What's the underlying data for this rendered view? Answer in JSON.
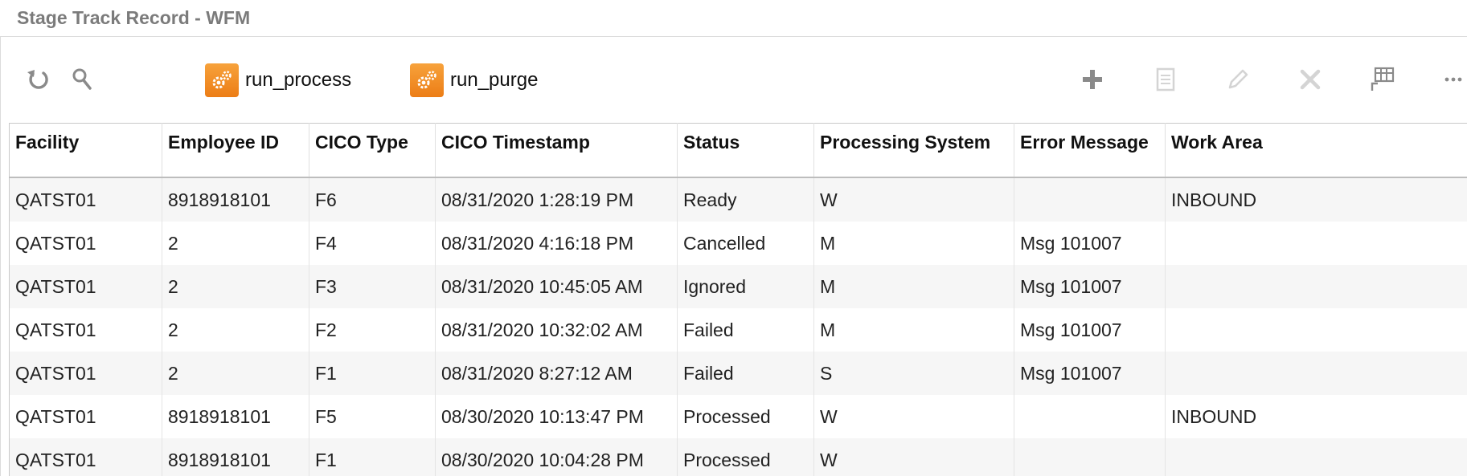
{
  "page": {
    "title": "Stage Track Record - WFM"
  },
  "toolbar": {
    "refresh_icon": "refresh-icon",
    "search_icon": "search-icon",
    "actions": [
      {
        "label": "run_process",
        "icon": "gears-icon"
      },
      {
        "label": "run_purge",
        "icon": "gears-icon"
      }
    ],
    "right_icons": [
      "add-icon",
      "copy-icon",
      "edit-icon",
      "delete-icon",
      "table-settings-icon",
      "more-icon"
    ],
    "accent_color": "#f08a24"
  },
  "grid": {
    "columns": [
      "Facility",
      "Employee ID",
      "CICO Type",
      "CICO Timestamp",
      "Status",
      "Processing System",
      "Error Message",
      "Work Area"
    ],
    "rows": [
      [
        "QATST01",
        "8918918101",
        "F6",
        "08/31/2020 1:28:19 PM",
        "Ready",
        "W",
        "",
        "INBOUND"
      ],
      [
        "QATST01",
        "2",
        "F4",
        "08/31/2020 4:16:18 PM",
        "Cancelled",
        "M",
        "Msg 101007",
        ""
      ],
      [
        "QATST01",
        "2",
        "F3",
        "08/31/2020 10:45:05 AM",
        "Ignored",
        "M",
        "Msg 101007",
        ""
      ],
      [
        "QATST01",
        "2",
        "F2",
        "08/31/2020 10:32:02 AM",
        "Failed",
        "M",
        "Msg 101007",
        ""
      ],
      [
        "QATST01",
        "2",
        "F1",
        "08/31/2020 8:27:12 AM",
        "Failed",
        "S",
        "Msg 101007",
        ""
      ],
      [
        "QATST01",
        "8918918101",
        "F5",
        "08/30/2020 10:13:47 PM",
        "Processed",
        "W",
        "",
        "INBOUND"
      ],
      [
        "QATST01",
        "8918918101",
        "F1",
        "08/30/2020 10:04:28 PM",
        "Processed",
        "W",
        "",
        ""
      ]
    ]
  }
}
